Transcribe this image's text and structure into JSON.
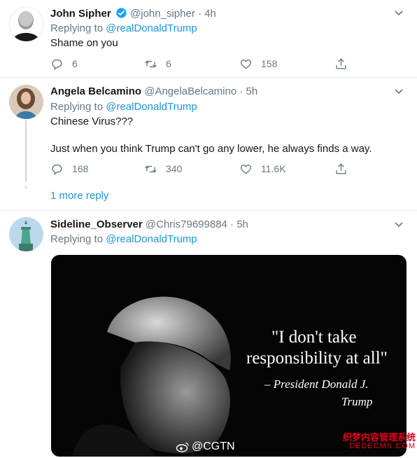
{
  "tweets": [
    {
      "name": "John Sipher",
      "handle": "@john_sipher",
      "time": "4h",
      "replying_label": "Replying to",
      "replying_to": "@realDonaldTrump",
      "text": "Shame on you",
      "replies": "6",
      "retweets": "6",
      "likes": "158",
      "verified": true
    },
    {
      "name": "Angela Belcamino",
      "handle": "@AngelaBelcamino",
      "time": "5h",
      "replying_label": "Replying to",
      "replying_to": "@realDonaldTrump",
      "text": "Chinese Virus???",
      "text2": "Just when you think Trump can't go any lower, he always finds a way.",
      "replies": "168",
      "retweets": "340",
      "likes": "11.6K"
    },
    {
      "name": "Sideline_Observer",
      "handle": "@Chris79699884",
      "time": "5h",
      "replying_label": "Replying to",
      "replying_to": "@realDonaldTrump"
    }
  ],
  "thread": {
    "more_reply": "1 more reply"
  },
  "media": {
    "quote_line1": "\"I don't take",
    "quote_line2": "responsibility at all\"",
    "attribution_line1": "– President Donald J.",
    "attribution_line2": "Trump",
    "source": "@CGTN"
  },
  "watermark": {
    "line1": "织梦内容管理系统",
    "line2": "DEDECMS.COM"
  },
  "colors": {
    "link": "#1b95e0",
    "muted": "#657786",
    "divider": "#e6ecf0",
    "verified": "#1da1f2"
  },
  "icons": [
    "reply-icon",
    "retweet-icon",
    "like-icon",
    "share-icon",
    "chevron-down-icon",
    "verified-badge-icon",
    "weibo-icon"
  ]
}
